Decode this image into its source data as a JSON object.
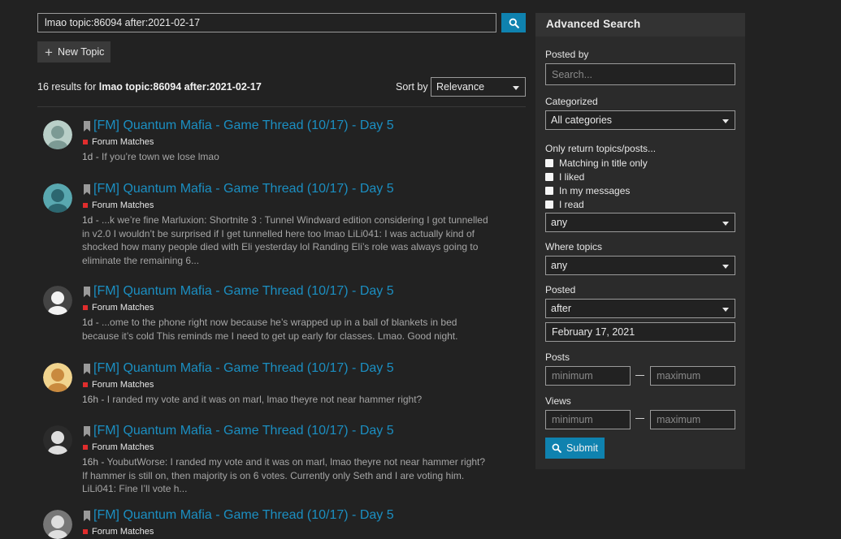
{
  "search": {
    "query": "lmao topic:86094 after:2021-02-17",
    "new_topic_label": "New Topic"
  },
  "results_header": {
    "count_text": "16 results for ",
    "query_bold": "lmao topic:86094 after:2021-02-17",
    "sort_label": "Sort by",
    "sort_value": "Relevance"
  },
  "results": [
    {
      "title": "[FM] Quantum Mafia - Game Thread (10/17) - Day 5",
      "category": "Forum Matches",
      "date": "1d",
      "blurb": "If you’re town we lose lmao"
    },
    {
      "title": "[FM] Quantum Mafia - Game Thread (10/17) - Day 5",
      "category": "Forum Matches",
      "date": "1d",
      "blurb": "...k we’re fine Marluxion: Shortnite 3 : Tunnel Windward edition considering I got tunnelled in v2.0 I wouldn’t be surprised if I get tunnelled here too lmao LiLi041: I was actually kind of shocked how many people died with Eli yesterday lol Randing Eli’s role was always going to eliminate the remaining 6..."
    },
    {
      "title": "[FM] Quantum Mafia - Game Thread (10/17) - Day 5",
      "category": "Forum Matches",
      "date": "1d",
      "blurb": "...ome to the phone right now because he’s wrapped up in a ball of blankets in bed because it’s cold This reminds me I need to get up early for classes. Lmao. Good night."
    },
    {
      "title": "[FM] Quantum Mafia - Game Thread (10/17) - Day 5",
      "category": "Forum Matches",
      "date": "16h",
      "blurb": "I randed my vote and it was on marl, lmao theyre not near hammer right?"
    },
    {
      "title": "[FM] Quantum Mafia - Game Thread (10/17) - Day 5",
      "category": "Forum Matches",
      "date": "16h",
      "blurb": "YoubutWorse: I randed my vote and it was on marl, lmao theyre not near hammer right? If hammer is still on, then majority is on 6 votes. Currently only Seth and I are voting him. LiLi041: Fine I’ll vote h..."
    },
    {
      "title": "[FM] Quantum Mafia - Game Thread (10/17) - Day 5",
      "category": "Forum Matches",
      "date": "",
      "blurb": ""
    }
  ],
  "date_separator": " - ",
  "advanced": {
    "heading": "Advanced Search",
    "posted_by_label": "Posted by",
    "posted_by_placeholder": "Search...",
    "categorized_label": "Categorized",
    "categorized_value": "All categories",
    "only_return_label": "Only return topics/posts...",
    "checkboxes": [
      "Matching in title only",
      "I liked",
      "In my messages",
      "I read"
    ],
    "only_return_select": "any",
    "where_topics_label": "Where topics",
    "where_topics_value": "any",
    "posted_label": "Posted",
    "posted_value": "after",
    "posted_date": "February 17, 2021",
    "posts_label": "Posts",
    "posts_min_placeholder": "minimum",
    "posts_max_placeholder": "maximum",
    "views_label": "Views",
    "views_min_placeholder": "minimum",
    "views_max_placeholder": "maximum",
    "submit_label": "Submit"
  },
  "colors": {
    "accent": "#0f82af",
    "link": "#1b8fc2",
    "category_badge": "#e02d2d",
    "background": "#222222",
    "panel": "#2b2b2b"
  },
  "icons": [
    "search-icon",
    "plus-icon",
    "bookmark-icon",
    "chevron-down-icon"
  ]
}
